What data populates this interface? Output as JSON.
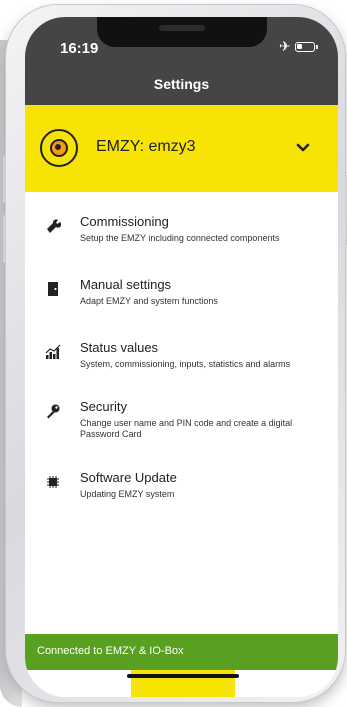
{
  "status_bar": {
    "time": "16:19"
  },
  "header": {
    "title": "Settings"
  },
  "device": {
    "name": "EMZY: emzy3"
  },
  "menu": {
    "items": [
      {
        "label": "Commissioning",
        "description": "Setup the EMZY including connected components",
        "icon": "wrench-icon"
      },
      {
        "label": "Manual settings",
        "description": "Adapt EMZY and system functions",
        "icon": "door-icon"
      },
      {
        "label": "Status values",
        "description": "System, commissioning, inputs, statistics and alarms",
        "icon": "bar-chart-icon"
      },
      {
        "label": "Security",
        "description": "Change user name and PIN code and create a digital Password Card",
        "icon": "key-icon"
      },
      {
        "label": "Software Update",
        "description": "Updating EMZY system",
        "icon": "chip-icon"
      }
    ]
  },
  "toast": {
    "message": "Connected to EMZY & IO-Box"
  },
  "colors": {
    "header": "#454545",
    "accent": "#f7e304",
    "toast": "#5aa020"
  }
}
